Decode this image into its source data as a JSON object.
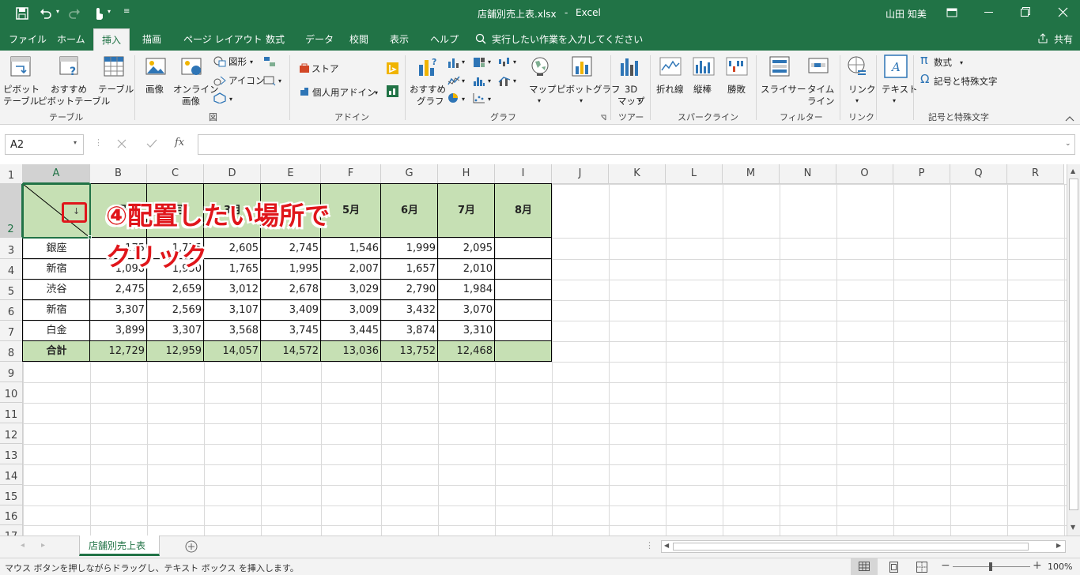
{
  "titlebar": {
    "filename": "店舗別売上表.xlsx",
    "separator": "-",
    "app": "Excel",
    "user": "山田 知美"
  },
  "tabs": [
    "ファイル",
    "ホーム",
    "挿入",
    "描画",
    "ページ レイアウト",
    "数式",
    "データ",
    "校閲",
    "表示",
    "ヘルプ"
  ],
  "active_tab": "挿入",
  "tell_me": "実行したい作業を入力してください",
  "share": "共有",
  "ribbon": {
    "pivot": [
      "ピボット",
      "テーブル"
    ],
    "rec_pivot": [
      "おすすめ",
      "ピボットテーブル"
    ],
    "table": "テーブル",
    "group_table": "テーブル",
    "image": "画像",
    "online_image": [
      "オンライン",
      "画像"
    ],
    "shapes": "図形",
    "icons": "アイコン",
    "group_fig": "図",
    "store": "ストア",
    "personal_addin": "個人用アドイン",
    "group_addin": "アドイン",
    "rec_chart": [
      "おすすめ",
      "グラフ"
    ],
    "map": "マップ",
    "pivot_chart": "ピボットグラフ",
    "group_chart": "グラフ",
    "map3d": [
      "3D",
      "マップ"
    ],
    "group_tour": "ツアー",
    "line": "折れ線",
    "column": "縦棒",
    "winloss": "勝敗",
    "group_spark": "スパークライン",
    "slicer": "スライサー",
    "timeline": [
      "タイム",
      "ライン"
    ],
    "group_filter": "フィルター",
    "link": "リンク",
    "group_link": "リンク",
    "text": "テキスト",
    "equation": "数式",
    "symbol": "記号と特殊文字",
    "group_symbol": "記号と特殊文字"
  },
  "formula_bar": {
    "name_box": "A2",
    "fx": "fx",
    "formula": ""
  },
  "columns": [
    "A",
    "B",
    "C",
    "D",
    "E",
    "F",
    "G",
    "H",
    "I",
    "J",
    "K",
    "L",
    "M",
    "N",
    "O",
    "P",
    "Q",
    "R"
  ],
  "rows": [
    "1",
    "2",
    "3",
    "4",
    "5",
    "6",
    "7",
    "8",
    "9",
    "10",
    "11",
    "12",
    "13",
    "14",
    "15",
    "16",
    "17"
  ],
  "table": {
    "title": "店舗別売上表",
    "header": [
      "1月",
      "2月",
      "3月",
      "4月",
      "5月",
      "6月",
      "7月",
      "8月"
    ],
    "data": [
      [
        "銀座",
        "1,175",
        "1,775",
        "2,605",
        "2,745",
        "1,546",
        "1,999",
        "2,095",
        ""
      ],
      [
        "新宿",
        "1,098",
        "1,950",
        "1,765",
        "1,995",
        "2,007",
        "1,657",
        "2,010",
        ""
      ],
      [
        "渋谷",
        "2,475",
        "2,659",
        "3,012",
        "2,678",
        "3,029",
        "2,790",
        "1,984",
        ""
      ],
      [
        "新宿",
        "3,307",
        "2,569",
        "3,107",
        "3,409",
        "3,009",
        "3,432",
        "3,070",
        ""
      ],
      [
        "白金",
        "3,899",
        "3,307",
        "3,568",
        "3,745",
        "3,445",
        "3,874",
        "3,310",
        ""
      ]
    ],
    "total": [
      "合計",
      "12,729",
      "12,959",
      "14,057",
      "14,572",
      "13,036",
      "13,752",
      "12,468",
      ""
    ]
  },
  "callout": {
    "line1": "④配置したい場所で",
    "line2": "クリック"
  },
  "sheet_tab": "店舗別売上表",
  "status": "マウス ボタンを押しながらドラッグし、テキスト ボックス を挿入します。",
  "zoom": "100%",
  "colors": {
    "excel_green": "#217346",
    "header_fill": "#c6e0b4",
    "callout_red": "#e0161b"
  }
}
